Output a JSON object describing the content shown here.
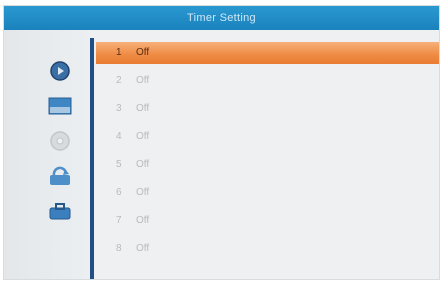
{
  "title": "Timer Setting",
  "sidebar": {
    "icons": [
      "play-icon",
      "picture-icon",
      "disc-icon",
      "refresh-icon",
      "toolbox-icon"
    ]
  },
  "timers": [
    {
      "num": "1",
      "state": "Off"
    },
    {
      "num": "2",
      "state": "Off"
    },
    {
      "num": "3",
      "state": "Off"
    },
    {
      "num": "4",
      "state": "Off"
    },
    {
      "num": "5",
      "state": "Off"
    },
    {
      "num": "6",
      "state": "Off"
    },
    {
      "num": "7",
      "state": "Off"
    },
    {
      "num": "8",
      "state": "Off"
    }
  ],
  "selected_index": 0,
  "colors": {
    "title_bar": "#1a82bd",
    "highlight": "#ee8a43",
    "divider": "#1f4f86"
  }
}
